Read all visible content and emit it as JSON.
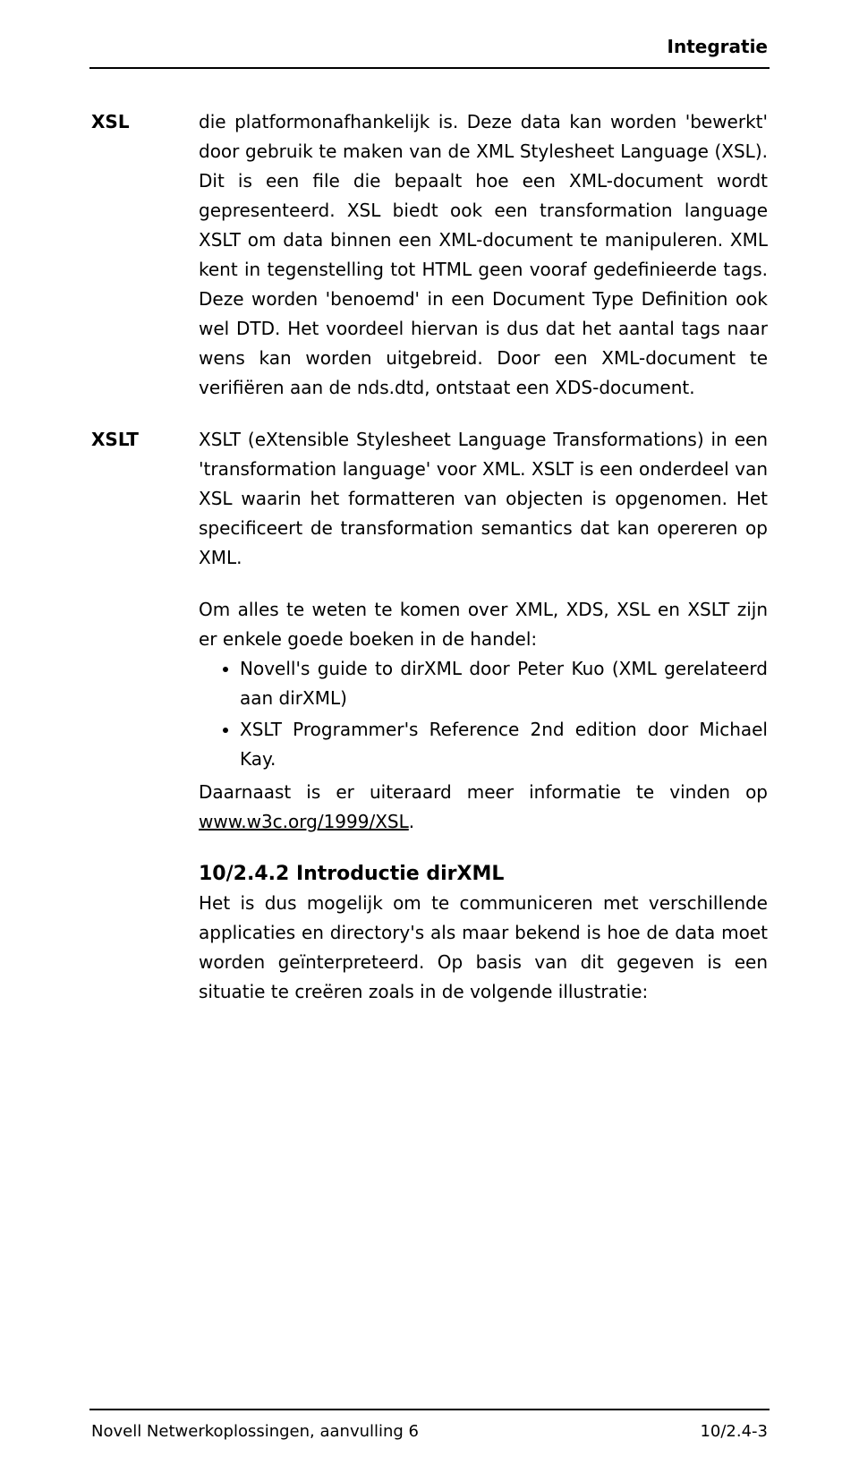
{
  "header": {
    "title": "Integratie"
  },
  "sections": {
    "xsl": {
      "label": "XSL",
      "body": "die platformonafhankelijk is. Deze data kan worden 'bewerkt' door gebruik te maken van de XML Stylesheet Language (XSL). Dit is een file die bepaalt hoe een XML-document wordt gepresenteerd. XSL biedt ook een transformation language XSLT om data binnen een XML-document te manipuleren. XML kent in tegenstelling tot HTML geen vooraf gedefinieerde tags. Deze worden 'benoemd' in een Document Type Definition ook wel DTD. Het voordeel hiervan is dus dat het aantal tags naar wens kan worden uitgebreid. Door een XML-document te verifiëren aan de nds.dtd, ontstaat een XDS-document."
    },
    "xslt": {
      "label": "XSLT",
      "body": "XSLT (eXtensible Stylesheet Language Transformations) in een 'transformation language' voor XML. XSLT is een onderdeel van XSL waarin het formatteren van objecten is opgenomen. Het specificeert de transformation semantics dat kan opereren op XML."
    },
    "books": {
      "intro": "Om alles te weten te komen over XML, XDS, XSL en XSLT zijn er enkele goede boeken in de handel:",
      "items": [
        "Novell's guide to dirXML door Peter Kuo (XML gerelateerd aan dirXML)",
        "XSLT Programmer's Reference 2nd edition door Michael Kay."
      ],
      "outro_pre": "Daarnaast is er uiteraard meer informatie te vinden op ",
      "outro_link": "www.w3c.org/1999/XSL",
      "outro_post": "."
    },
    "intro_dirxml": {
      "heading": "10/2.4.2 Introductie dirXML",
      "body": "Het is dus mogelijk om te communiceren met verschillende applicaties en directory's als maar bekend is hoe de data moet worden geïnterpreteerd. Op basis van dit gegeven is een situatie te creëren zoals in de volgende illustratie:"
    }
  },
  "footer": {
    "left": "Novell Netwerkoplossingen, aanvulling 6",
    "right": "10/2.4-3"
  }
}
